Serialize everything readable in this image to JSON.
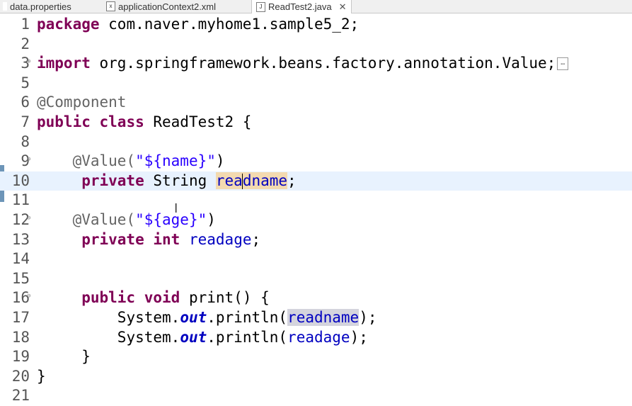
{
  "tabs": [
    {
      "label": "data.properties",
      "icon": "properties-file-icon",
      "active": false
    },
    {
      "label": "applicationContext2.xml",
      "icon": "xml-file-icon",
      "active": false
    },
    {
      "label": "ReadTest2.java",
      "icon": "java-file-icon",
      "active": true,
      "close": "✕"
    }
  ],
  "lines": {
    "n1": "1",
    "n2": "2",
    "n3": "3",
    "n5": "5",
    "n6": "6",
    "n7": "7",
    "n8": "8",
    "n9": "9",
    "n10": "10",
    "n11": "11",
    "n12": "12",
    "n13": "13",
    "n14": "14",
    "n15": "15",
    "n16": "16",
    "n17": "17",
    "n18": "18",
    "n19": "19",
    "n20": "20",
    "n21": "21"
  },
  "code": {
    "kw_package": "package",
    "package_name": " com.naver.myhome1.sample5_2;",
    "kw_import": "import",
    "import_name": " org.springframework.beans.factory.annotation.Value;",
    "collapsed_marker": "…",
    "ann_component": "@Component",
    "kw_public": "public",
    "kw_class": "class",
    "class_decl": " ReadTest2 {",
    "ann_value": "@Value(",
    "str_name": "\"${name}\"",
    "close_paren": ")",
    "kw_private": "private",
    "type_string": " String ",
    "field_readname_a": "rea",
    "field_readname_b": "dname",
    "semicolon": ";",
    "str_age": "\"${age}\"",
    "kw_int": "int",
    "field_readage": "readage",
    "kw_void": "void",
    "method_decl": " print() {",
    "system": "System.",
    "out": "out",
    "println": ".println(",
    "readname": "readname",
    "readage": "readage",
    "call_end": ");",
    "brace_close": "}"
  }
}
